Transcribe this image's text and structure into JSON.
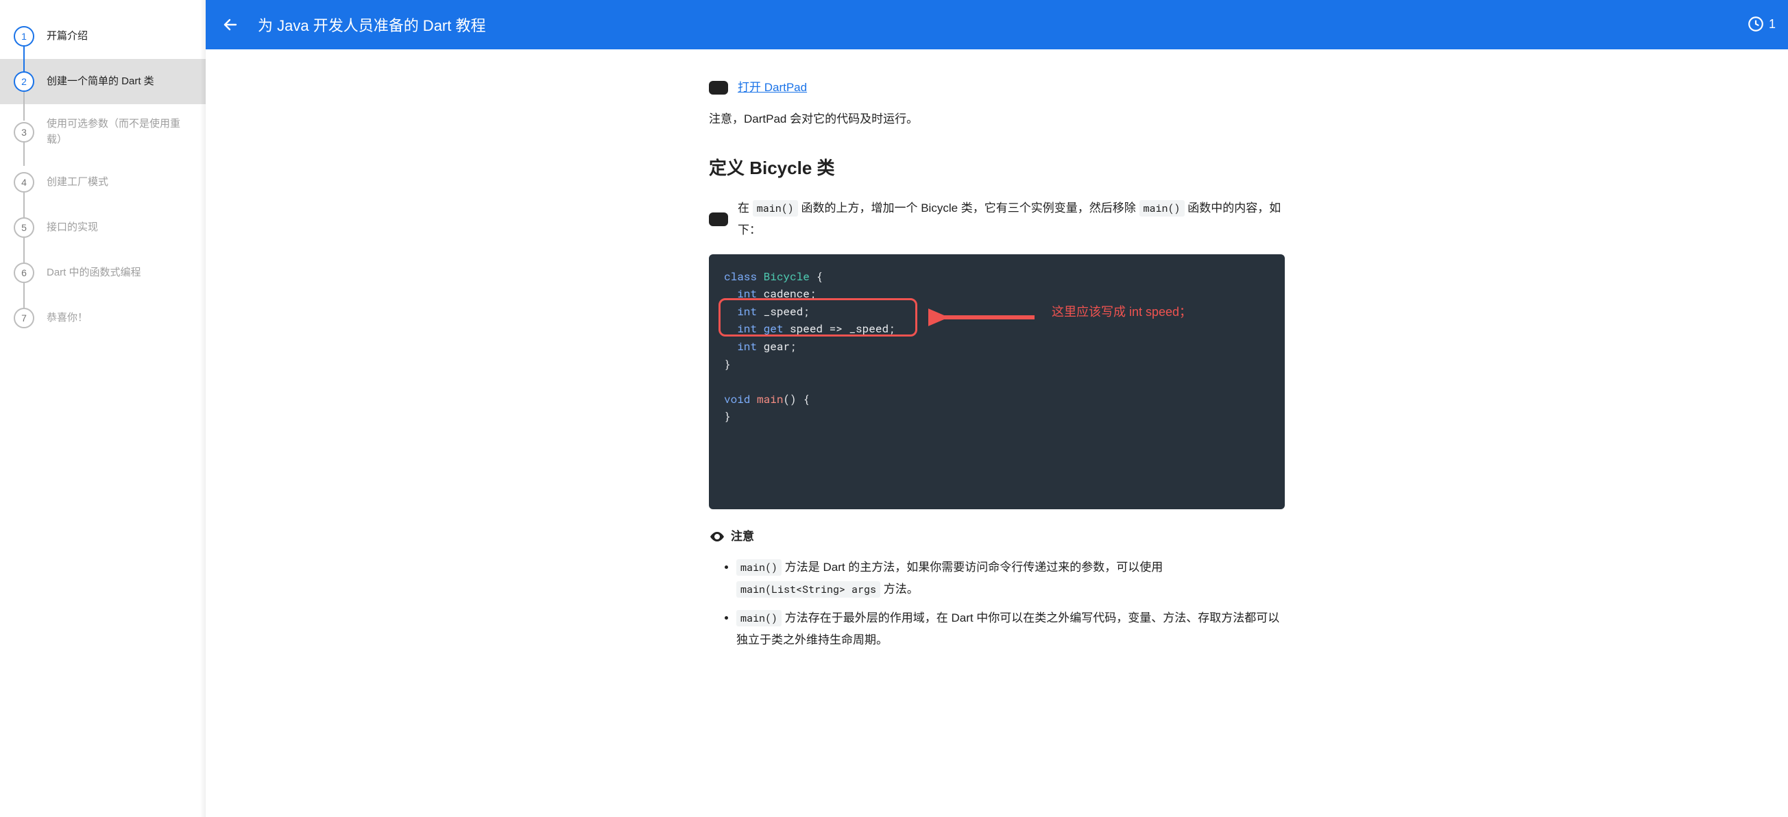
{
  "header": {
    "title": "为 Java 开发人员准备的 Dart 教程",
    "clock_value": "1"
  },
  "sidebar": {
    "steps": [
      {
        "num": "1",
        "label": "开篇介绍"
      },
      {
        "num": "2",
        "label": "创建一个简单的 Dart 类"
      },
      {
        "num": "3",
        "label": "使用可选参数（而不是使用重载）"
      },
      {
        "num": "4",
        "label": "创建工厂模式"
      },
      {
        "num": "5",
        "label": "接口的实现"
      },
      {
        "num": "6",
        "label": "Dart 中的函数式编程"
      },
      {
        "num": "7",
        "label": "恭喜你！"
      }
    ]
  },
  "content": {
    "dartpad_link": "打开 DartPad",
    "note_dartpad": "注意，DartPad 会对它的代码及时运行。",
    "section_title": "定义 Bicycle 类",
    "section_intro_pre": "在 ",
    "section_intro_mid": " 函数的上方，增加一个 Bicycle 类，它有三个实例变量，然后移除 ",
    "section_intro_post": " 函数中的内容，如下：",
    "code_main1": "main()",
    "code_main2": "main()",
    "annotation_text": "这里应该写成 int speed；",
    "note_title": "注意",
    "bullets": [
      {
        "pre": "",
        "code1": "main()",
        "mid": " 方法是 Dart 的主方法，如果你需要访问命令行传递过来的参数，可以使用 ",
        "code2": "main(List<String> args",
        "post": " 方法。"
      },
      {
        "pre": "",
        "code1": "main()",
        "mid": " 方法存在于最外层的作用域，在 Dart 中你可以在类之外编写代码，变量、方法、存取方法都可以独立于类之外维持生命周期。",
        "code2": "",
        "post": ""
      }
    ],
    "code_block": {
      "l1a": "class",
      "l1b": " Bicycle",
      "l1c": " {",
      "l2a": "  int",
      "l2b": " cadence;",
      "l3a": "  int",
      "l3b": " _speed;",
      "l4a": "  int",
      "l4b": " get",
      "l4c": " speed => _speed;",
      "l5a": "  int",
      "l5b": " gear;",
      "l6": "}",
      "l7": "",
      "l8a": "void",
      "l8b": " main",
      "l8c": "()",
      "l8d": " {",
      "l9": "}"
    }
  }
}
